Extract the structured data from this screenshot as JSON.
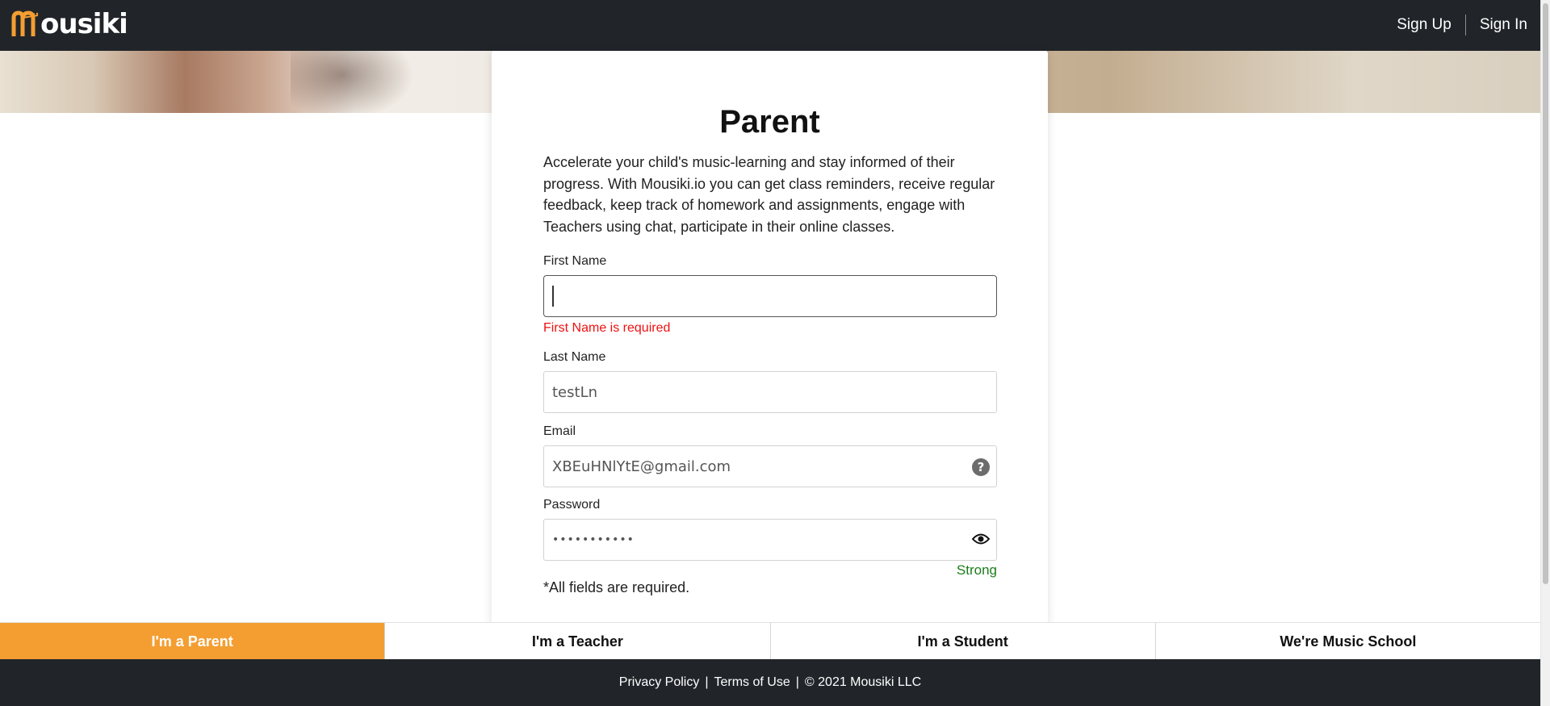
{
  "header": {
    "logo_text": "ousiki",
    "sign_up": "Sign Up",
    "sign_in": "Sign In"
  },
  "form": {
    "title": "Parent",
    "description": "Accelerate your child's music-learning and stay informed of their progress. With Mousiki.io you can get class reminders, receive regular feedback, keep track of homework and assignments, engage with Teachers using chat, participate in their online classes.",
    "first_name": {
      "label": "First Name",
      "value": "",
      "error": "First Name is required"
    },
    "last_name": {
      "label": "Last Name",
      "value": "testLn"
    },
    "email": {
      "label": "Email",
      "value": "XBEuHNlYtE@gmail.com",
      "help": "?"
    },
    "password": {
      "label": "Password",
      "masked_value": "•••••••••••",
      "strength": "Strong"
    },
    "required_note": "*All fields are required."
  },
  "role_tabs": [
    {
      "label": "I'm a Parent",
      "active": true
    },
    {
      "label": "I'm a Teacher",
      "active": false
    },
    {
      "label": "I'm a Student",
      "active": false
    },
    {
      "label": "We're Music School",
      "active": false
    }
  ],
  "footer": {
    "privacy": "Privacy Policy",
    "terms": "Terms of Use",
    "separator": "|",
    "copyright": "© 2021 Mousiki LLC"
  },
  "colors": {
    "navbar": "#212529",
    "accent": "#f49e32",
    "error": "#ee1111",
    "strength": "#1b7c1b"
  },
  "icons": {
    "logo": "guitar-m-logo-icon",
    "email_help": "question-circle-icon",
    "password_toggle": "eye-icon"
  }
}
